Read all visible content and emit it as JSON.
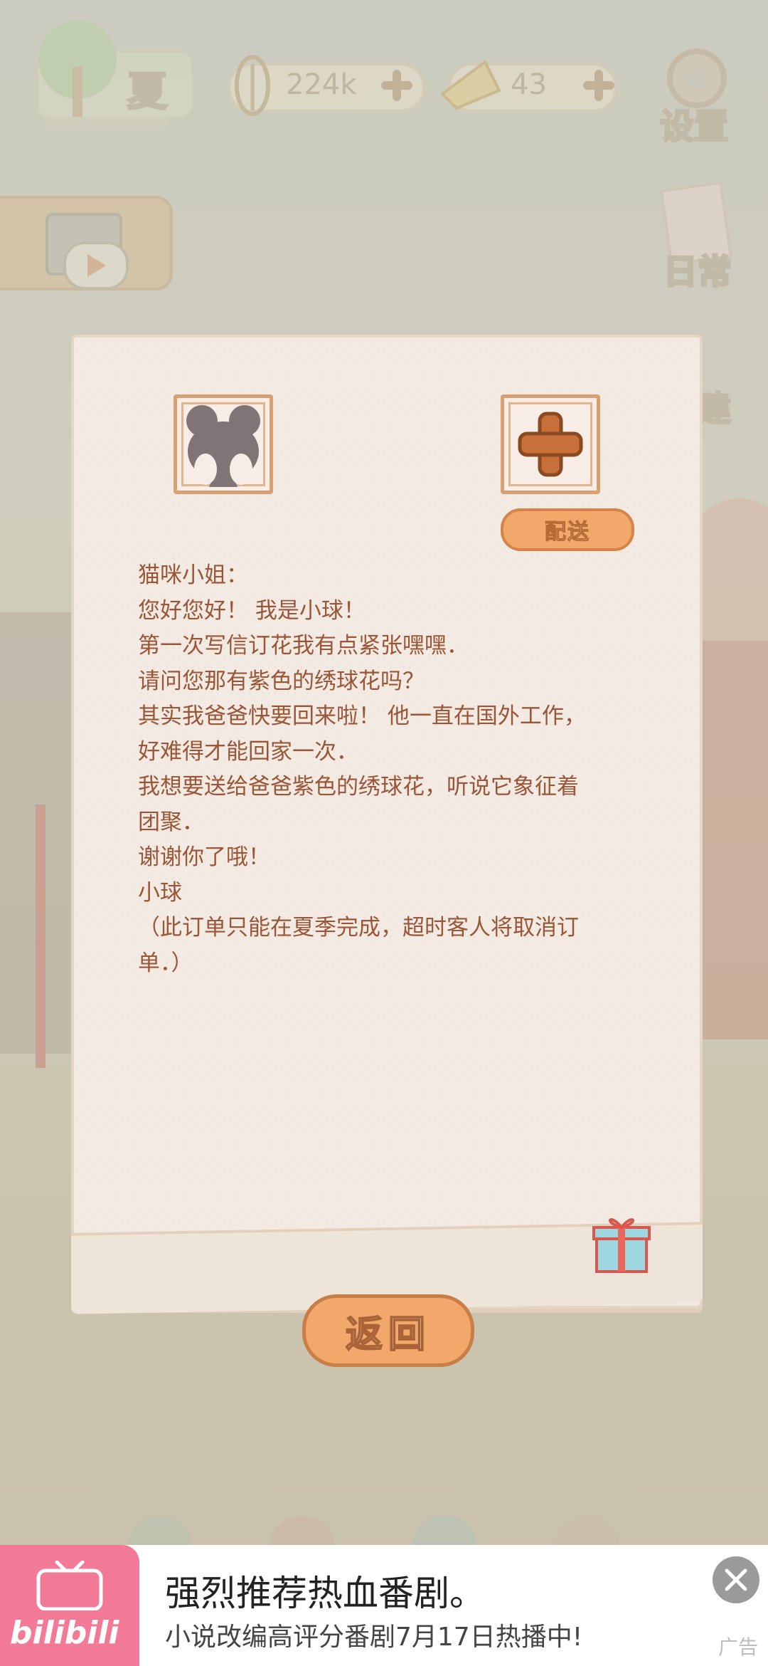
{
  "hud": {
    "season_label": "夏",
    "fish_value": "224k",
    "cheese_value": "43",
    "settings_label": "设置",
    "daily_label": "日常",
    "build_label": "建"
  },
  "letter": {
    "deliver_label": "配送",
    "lines": [
      "猫咪小姐：",
      "您好您好！ 我是小球！",
      "第一次写信订花我有点紧张嘿嘿．",
      "请问您那有紫色的绣球花吗？",
      "其实我爸爸快要回来啦！ 他一直在国外工作，",
      "好难得才能回家一次．",
      "我想要送给爸爸紫色的绣球花，听说它象征着",
      "团聚．",
      "谢谢你了哦！",
      "小球",
      "（此订单只能在夏季完成，超时客人将取消订",
      "单．）"
    ],
    "return_label": "返回"
  },
  "ad": {
    "logo_text": "bilibili",
    "title": "强烈推荐热血番剧。",
    "subtitle": "小说改编高评分番剧7月17日热播中!",
    "ad_tag": "广告"
  },
  "colors": {
    "letter_text": "#9a5637",
    "accent_orange": "#f2a86a",
    "ad_logo_pink": "#f27a97"
  }
}
